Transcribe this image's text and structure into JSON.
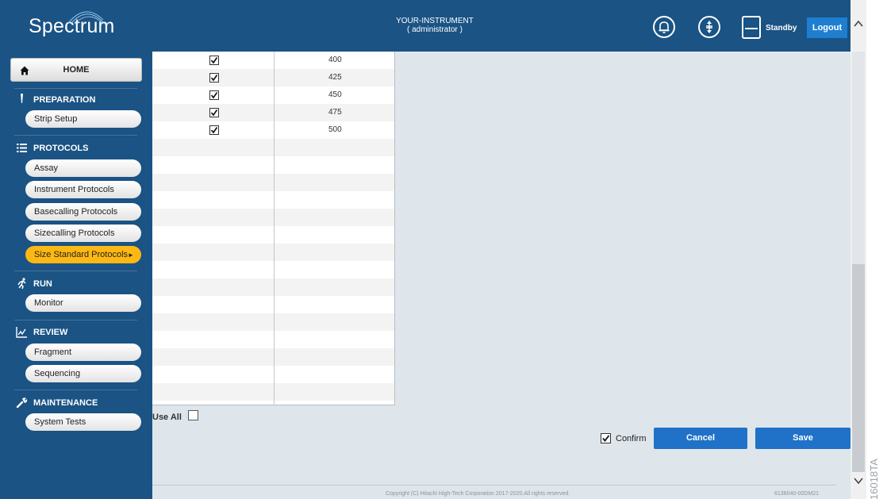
{
  "header": {
    "logo": "Spectrum",
    "instrument_name": "YOUR-INSTRUMENT",
    "user_role": "( administrator )",
    "standby_label": "Standby",
    "logout_label": "Logout"
  },
  "sidebar": {
    "home_label": "HOME",
    "sections": [
      {
        "title": "PREPARATION",
        "items": [
          "Strip Setup"
        ]
      },
      {
        "title": "PROTOCOLS",
        "items": [
          "Assay",
          "Instrument Protocols",
          "Basecalling Protocols",
          "Sizecalling Protocols",
          "Size Standard Protocols"
        ]
      },
      {
        "title": "RUN",
        "items": [
          "Monitor"
        ]
      },
      {
        "title": "REVIEW",
        "items": [
          "Fragment",
          "Sequencing"
        ]
      },
      {
        "title": "MAINTENANCE",
        "items": [
          "System Tests"
        ]
      }
    ],
    "active_item": "Size Standard Protocols"
  },
  "size_list": {
    "rows": [
      {
        "checked": true,
        "value": "400"
      },
      {
        "checked": true,
        "value": "425"
      },
      {
        "checked": true,
        "value": "450"
      },
      {
        "checked": true,
        "value": "475"
      },
      {
        "checked": true,
        "value": "500"
      }
    ]
  },
  "controls": {
    "use_all_label": "Use All",
    "use_all_checked": false,
    "confirm_label": "Confirm",
    "confirm_checked": true,
    "cancel_label": "Cancel",
    "save_label": "Save"
  },
  "footer": {
    "copyright": "Copyright (C) Hitachi High-Tech Corporation 2017-2020.All rights reserved.",
    "doc_number": "6138040-00DM21"
  },
  "side_code": "16018TA",
  "colors": {
    "header_bg": "#1a5384",
    "active_item": "#fdb813",
    "button_blue": "#1f72c7",
    "main_bg": "#dee6ec"
  }
}
